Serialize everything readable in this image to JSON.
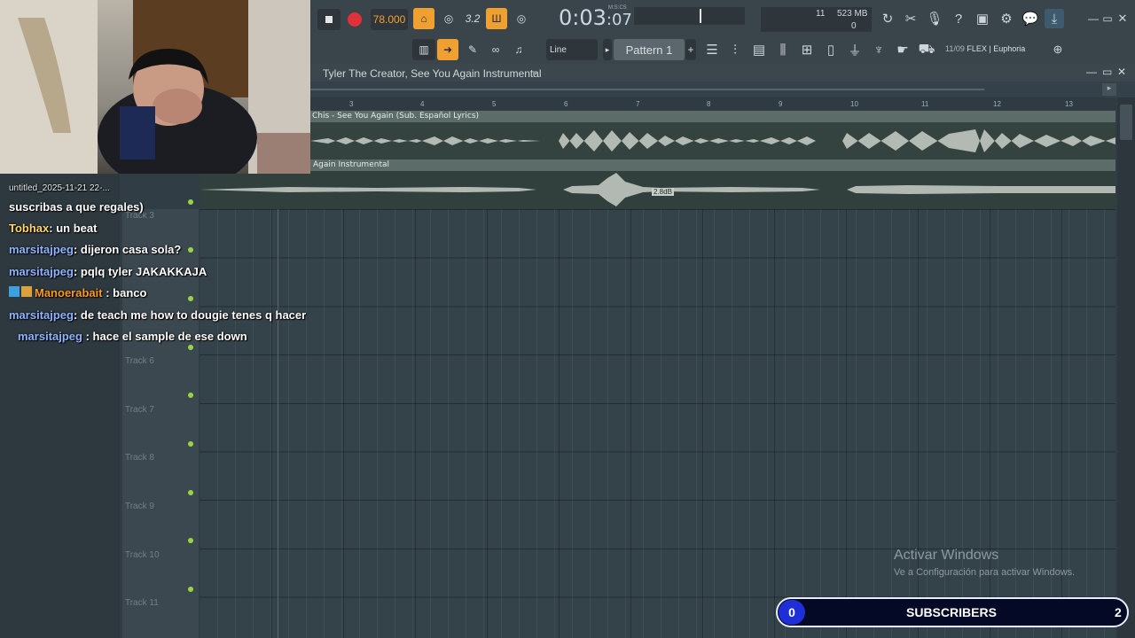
{
  "toolbar": {
    "tempo": "78.000",
    "time": "0:03",
    "time_sub": ":07",
    "time_unit": "M:S:CS",
    "cpu": "11",
    "memory": "523 MB",
    "poly": "0",
    "snap": "Line",
    "pattern": "Pattern 1",
    "hint_date": "11/09",
    "hint_text": "FLEX | Euphoria"
  },
  "playlist": {
    "title": "Tyler The Creator, See You Again Instrumental",
    "ruler": [
      "3",
      "4",
      "5",
      "6",
      "7",
      "8",
      "9",
      "10",
      "11",
      "12",
      "13"
    ],
    "clip1_name": "Chis - See You Again (Sub. Español  Lyrics)",
    "clip2_name": "Again Instrumental",
    "clip2_gain": "2.8dB",
    "tracks": [
      "Track 3",
      "Track 6",
      "Track 7",
      "Track 8",
      "Track 9",
      "Track 10",
      "Track 11"
    ]
  },
  "chat": {
    "overlay_text": "untitled_2025-11-21 22-...",
    "messages": [
      {
        "user": "",
        "text": "suscribas a que regales)"
      },
      {
        "user": "Tobhax",
        "text": ": un beat"
      },
      {
        "user": "marsitajpeg",
        "text": ": dijeron casa sola?"
      },
      {
        "user": "marsitajpeg",
        "text": ": pqlq tyler JAKAKKAJA"
      },
      {
        "user": "Manoerabait",
        "text": ": banco"
      },
      {
        "user": "marsitajpeg",
        "text": ": de teach me how to dougie tenes q hacer"
      },
      {
        "user": "marsitajpeg",
        "text": ": hace el sample de ese down"
      }
    ]
  },
  "watermark": {
    "title": "Activar Windows",
    "subtitle": "Ve a Configuración para activar Windows."
  },
  "subscribers": {
    "current": "0",
    "label": "SUBSCRIBERS",
    "goal": "2",
    "progress": 0
  },
  "colors": {
    "accent": "#f0a030",
    "chat_username": "#8fb3ff",
    "sub_bar_fill": "#1e2fd8"
  }
}
